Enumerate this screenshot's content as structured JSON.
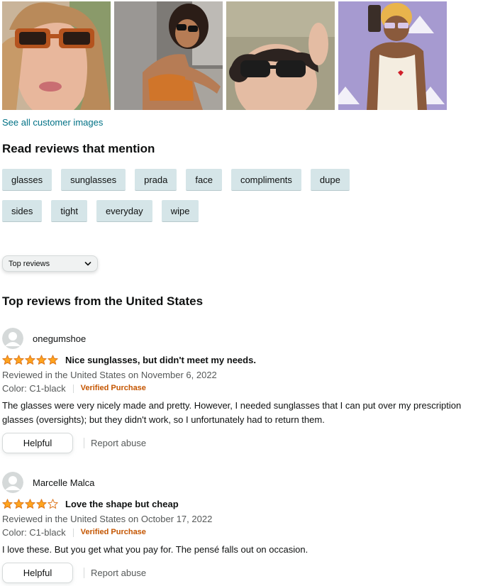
{
  "gallery": {
    "images": [
      {
        "alt": "customer-image-1"
      },
      {
        "alt": "customer-image-2"
      },
      {
        "alt": "customer-image-3"
      },
      {
        "alt": "customer-image-4"
      }
    ],
    "see_all_label": "See all customer images"
  },
  "mentions": {
    "title": "Read reviews that mention",
    "row1": [
      "glasses",
      "sunglasses",
      "prada",
      "face",
      "compliments",
      "dupe"
    ],
    "row2": [
      "sides",
      "tight",
      "everyday",
      "wipe"
    ]
  },
  "sort": {
    "selected": "Top reviews",
    "icon": "chevron-down-icon"
  },
  "reviews_section": {
    "title": "Top reviews from the United States"
  },
  "reviews": [
    {
      "name": "onegumshoe",
      "rating": 5,
      "title": "Nice sunglasses, but didn't meet my needs.",
      "meta": "Reviewed in the United States on November 6, 2022",
      "variant": "Color: C1-black",
      "verified": "Verified Purchase",
      "body": "The glasses were very nicely made and pretty. However, I needed sunglasses that I can put over my prescription glasses (oversights); but they didn't work, so I unfortunately had to return them.",
      "helpful_label": "Helpful",
      "report_label": "Report abuse"
    },
    {
      "name": "Marcelle Malca",
      "rating": 4,
      "title": "Love the shape but cheap",
      "meta": "Reviewed in the United States on October 17, 2022",
      "variant": "Color: C1-black",
      "verified": "Verified Purchase",
      "body": "I love these. But you get what you pay for. The pensé falls out on occasion.",
      "helpful_label": "Helpful",
      "report_label": "Report abuse"
    }
  ],
  "colors": {
    "link": "#007185",
    "star": "#ffa41c",
    "verified": "#c45500",
    "chip_bg": "#d5e5e8"
  }
}
